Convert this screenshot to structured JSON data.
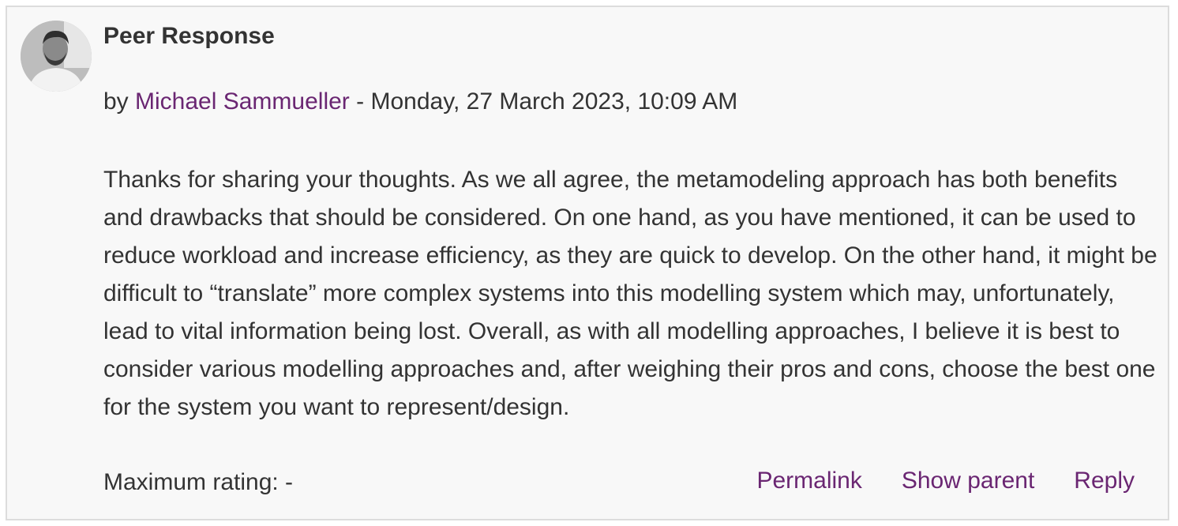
{
  "post": {
    "title": "Peer Response",
    "byline_prefix": "by",
    "author": "Michael Sammueller",
    "byline_separator": " - ",
    "date": "Monday, 27 March 2023, 10:09 AM",
    "content": "Thanks for sharing your thoughts. As we all agree, the metamodeling approach has both benefits and drawbacks that should be considered. On one hand, as you have mentioned, it can be used to reduce workload and increase efficiency, as they are quick to develop. On the other hand, it might be difficult to “translate” more complex systems into this modelling system which may, unfortunately, lead to vital information being lost. Overall, as with all modelling approaches, I believe it is best to consider various modelling approaches and, after weighing their pros and cons, choose the best one for the system you want to represent/design.",
    "rating_label": "Maximum rating: -",
    "commands": {
      "permalink": "Permalink",
      "show_parent": "Show parent",
      "reply": "Reply"
    }
  },
  "colors": {
    "link": "#6a2672",
    "text": "#333333",
    "background": "#f8f8f8",
    "border": "#dcdcdc"
  }
}
